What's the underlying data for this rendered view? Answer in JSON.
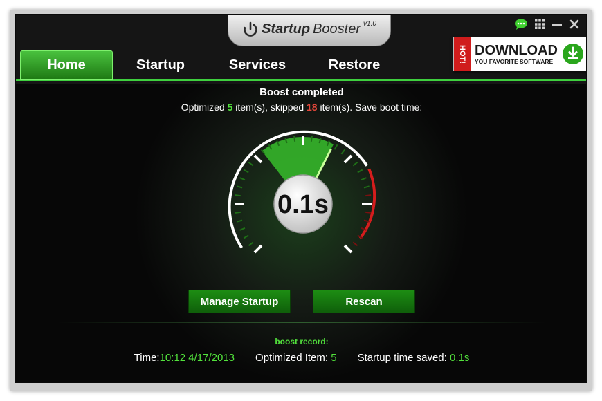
{
  "app": {
    "title_main": "Startup",
    "title_sub": "Booster",
    "version": "v1.0"
  },
  "window_controls": [
    "chat-icon",
    "grid-icon",
    "minimize-icon",
    "close-icon"
  ],
  "nav": {
    "tabs": [
      {
        "label": "Home",
        "active": true
      },
      {
        "label": "Startup",
        "active": false
      },
      {
        "label": "Services",
        "active": false
      },
      {
        "label": "Restore",
        "active": false
      }
    ]
  },
  "ad_badge": {
    "hot": "HOT!",
    "title": "DOWNLOAD",
    "subtitle": "YOU FAVORITE SOFTWARE",
    "icon": "download-icon"
  },
  "status": {
    "headline": "Boost completed",
    "prefix": "Optimized ",
    "optimized_count": "5",
    "middle": " item(s), skipped ",
    "skipped_count": "18",
    "suffix": " item(s). Save boot time:"
  },
  "gauge": {
    "value_label": "0.1s",
    "fraction": 0.6
  },
  "buttons": {
    "manage_startup": "Manage Startup",
    "rescan": "Rescan"
  },
  "record": {
    "title": "boost record:",
    "time_label": "Time:",
    "time_value": "10:12 4/17/2013",
    "optimized_label": "Optimized Item: ",
    "optimized_value": "5",
    "saved_label": "Startup time saved: ",
    "saved_value": "0.1s"
  },
  "colors": {
    "accent_green": "#52e13c",
    "tab_green": "#2a9a20",
    "warn_red": "#e2473a",
    "background": "#151515"
  }
}
